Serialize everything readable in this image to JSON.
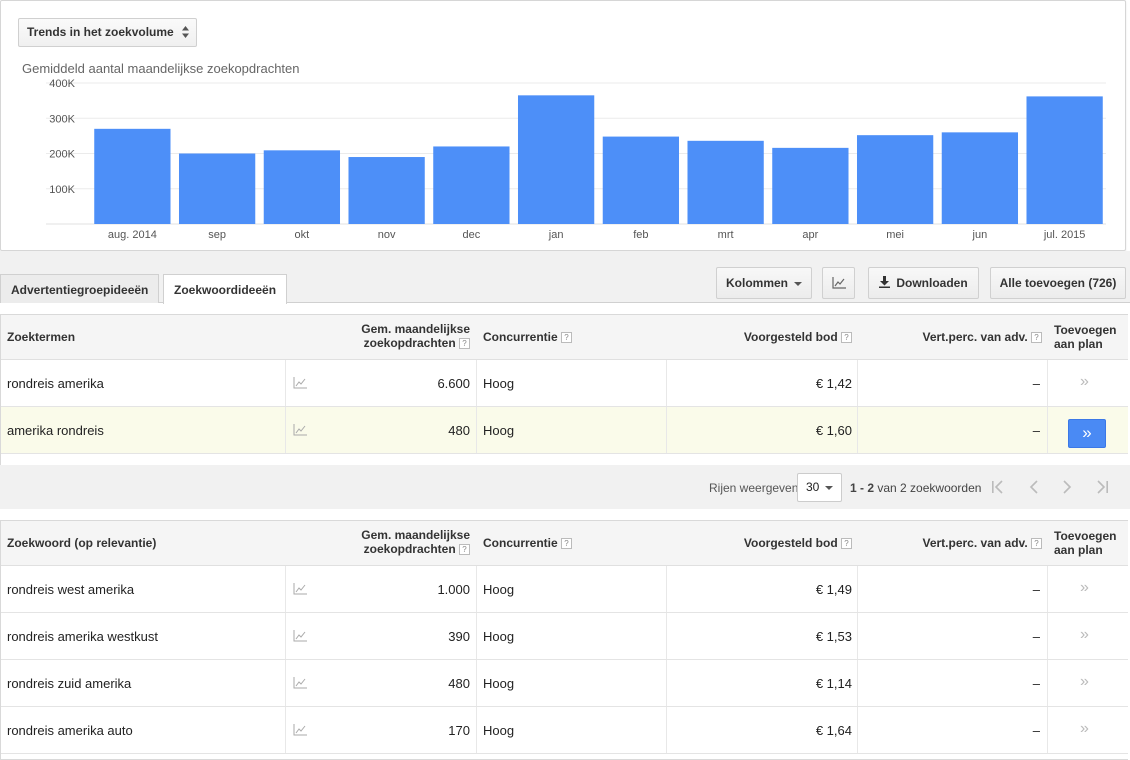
{
  "trend_select": {
    "label": "Trends in het zoekvolume"
  },
  "chart_data": {
    "type": "bar",
    "title": "Gemiddeld aantal maandelijkse zoekopdrachten",
    "categories": [
      "aug. 2014",
      "sep",
      "okt",
      "nov",
      "dec",
      "jan",
      "feb",
      "mrt",
      "apr",
      "mei",
      "jun",
      "jul. 2015"
    ],
    "values": [
      270000,
      200000,
      209000,
      190000,
      220000,
      365000,
      248000,
      236000,
      216000,
      252000,
      260000,
      362000
    ],
    "yticks": [
      "100K",
      "200K",
      "300K",
      "400K"
    ],
    "ylim": [
      0,
      400000
    ],
    "grid": true,
    "color": "#4d8ff8"
  },
  "tabs": [
    {
      "label": "Advertentiegroepideeën",
      "active": false
    },
    {
      "label": "Zoekwoordideeën",
      "active": true
    }
  ],
  "toolbar": {
    "columns_label": "Kolommen",
    "download_label": "Downloaden",
    "add_all_label": "Alle toevoegen (726)"
  },
  "table1": {
    "headers": {
      "term": "Zoektermen",
      "volume_l1": "Gem. maandelijkse",
      "volume_l2": "zoekopdrachten",
      "competition": "Concurrentie",
      "bid": "Voorgesteld bod",
      "share": "Vert.perc. van adv.",
      "add_l1": "Toevoegen",
      "add_l2": "aan plan"
    },
    "rows": [
      {
        "term": "rondreis amerika",
        "volume": "6.600",
        "competition": "Hoog",
        "bid": "€ 1,42",
        "share": "–"
      },
      {
        "term": "amerika rondreis",
        "volume": "480",
        "competition": "Hoog",
        "bid": "€ 1,60",
        "share": "–"
      }
    ]
  },
  "pager": {
    "rows_label": "Rijen weergeven:",
    "rows_value": "30",
    "range_bold": "1 - 2",
    "range_rest": "van 2 zoekwoorden"
  },
  "table2": {
    "headers": {
      "term": "Zoekwoord (op relevantie)",
      "volume_l1": "Gem. maandelijkse",
      "volume_l2": "zoekopdrachten",
      "competition": "Concurrentie",
      "bid": "Voorgesteld bod",
      "share": "Vert.perc. van adv.",
      "add_l1": "Toevoegen",
      "add_l2": "aan plan"
    },
    "rows": [
      {
        "term": "rondreis west amerika",
        "volume": "1.000",
        "competition": "Hoog",
        "bid": "€ 1,49",
        "share": "–"
      },
      {
        "term": "rondreis amerika westkust",
        "volume": "390",
        "competition": "Hoog",
        "bid": "€ 1,53",
        "share": "–"
      },
      {
        "term": "rondreis zuid amerika",
        "volume": "480",
        "competition": "Hoog",
        "bid": "€ 1,14",
        "share": "–"
      },
      {
        "term": "rondreis amerika auto",
        "volume": "170",
        "competition": "Hoog",
        "bid": "€ 1,64",
        "share": "–"
      }
    ]
  },
  "help_glyph": "?",
  "add_glyph": "»"
}
